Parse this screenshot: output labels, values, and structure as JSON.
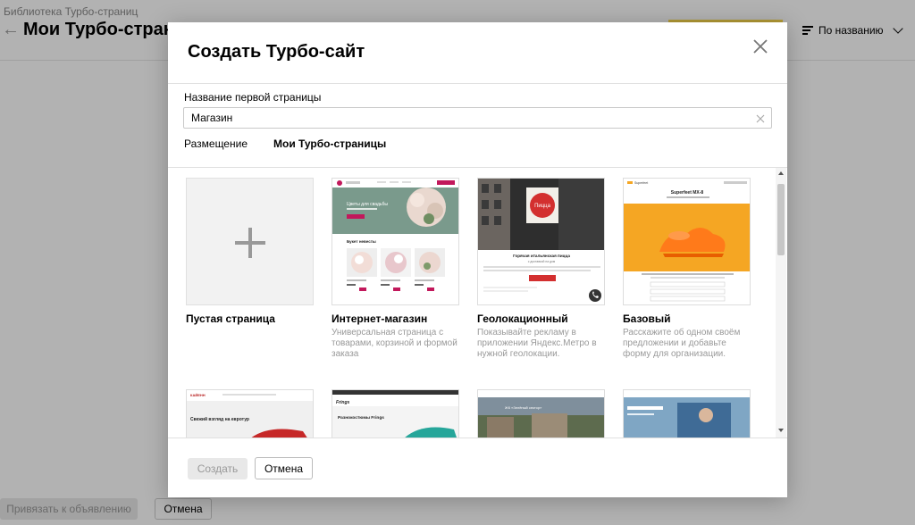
{
  "background": {
    "breadcrumb": "Библиотека Турбо-страниц",
    "title": "Мои Турбо-стран",
    "sort_label": "По названию",
    "attach_button": "Привязать к объявлению",
    "cancel_button": "Отмена"
  },
  "modal": {
    "title": "Создать Турбо-сайт",
    "field_label": "Название первой страницы",
    "field_value": "Магазин",
    "placement_label": "Размещение",
    "placement_value": "Мои Турбо-страницы",
    "templates": [
      {
        "title": "Пустая страница",
        "desc": ""
      },
      {
        "title": "Интернет-магазин",
        "desc": "Универсальная страница с товарами, корзиной и формой заказа"
      },
      {
        "title": "Геолокационный",
        "desc": "Показывайте рекламу в приложении Яндекс.Метро в нужной геолокации."
      },
      {
        "title": "Базовый",
        "desc": "Расскажите об одном своём предложении и добавьте форму для организации."
      }
    ],
    "preview_texts": {
      "shop_hero": "Цветы для свадьбы",
      "shop_section": "Букет невесты",
      "geo_pizza": "Пицца",
      "geo_heading": "Горячая итальянская пицца",
      "geo_sub": "с доставкой на дом",
      "basic_brand": "Superfeet",
      "basic_heading": "Superfeet MX-8",
      "row2_a_brand": "КАЙЕНН",
      "row2_a_text": "Свежий взгляд на евротур",
      "row2_b_brand": "Frings",
      "row2_b_text": "Разнокостюмы Frings",
      "row2_c_text": "ЖК «Зелёный сектор»"
    },
    "create_button": "Создать",
    "cancel_button": "Отмена"
  },
  "colors": {
    "accent_yellow": "#ffdb4d",
    "shop_red": "#c2185b",
    "geo_red": "#d32f2f",
    "basic_orange": "#f5a623"
  }
}
